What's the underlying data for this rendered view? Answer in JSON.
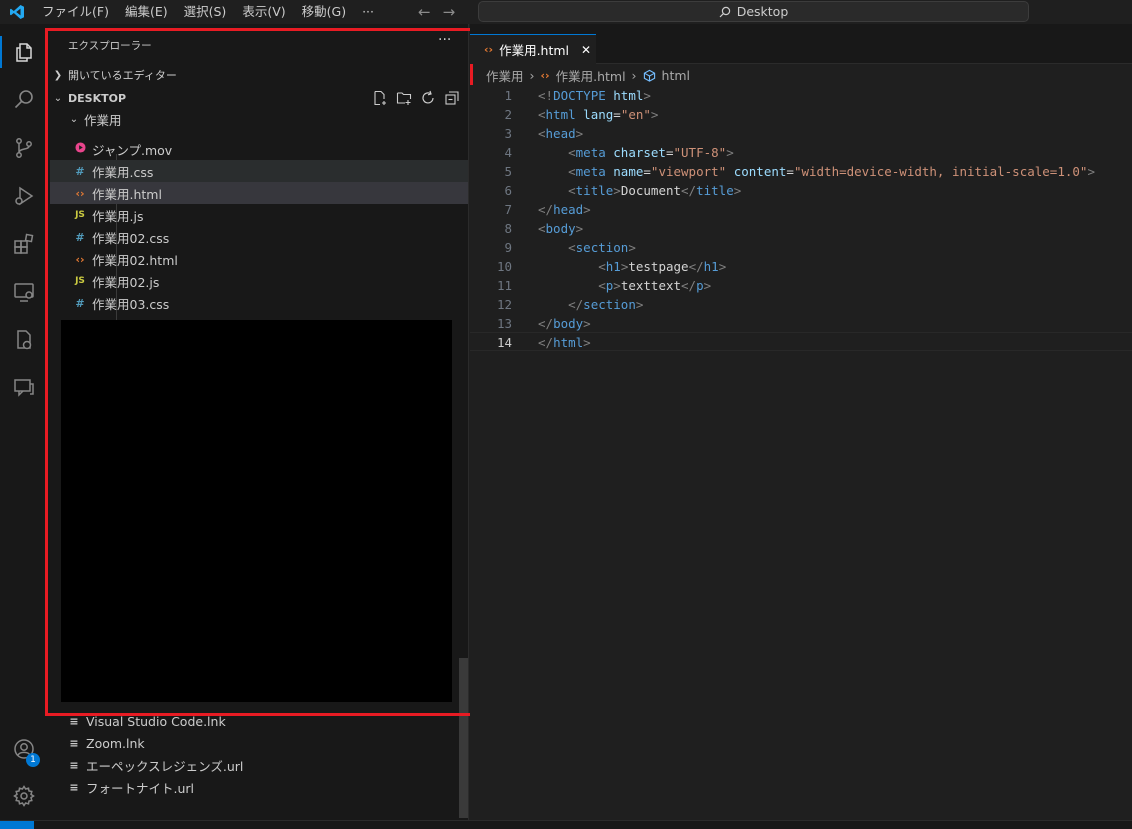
{
  "titlebar": {
    "menu": [
      "ファイル(F)",
      "編集(E)",
      "選択(S)",
      "表示(V)",
      "移動(G)",
      "···"
    ],
    "search_label": "Desktop"
  },
  "activity": {
    "account_badge": "1"
  },
  "explorer": {
    "header": "エクスプローラー",
    "more": "···",
    "open_editors": "開いているエディター",
    "workspace": "DESKTOP",
    "folder": "作業用",
    "files_top": [
      {
        "name": "ジャンプ.mov",
        "icon": "video-file-icon"
      },
      {
        "name": "作業用.css",
        "icon": "css-file-icon"
      },
      {
        "name": "作業用.html",
        "icon": "html-file-icon"
      },
      {
        "name": "作業用.js",
        "icon": "js-file-icon"
      },
      {
        "name": "作業用02.css",
        "icon": "css-file-icon"
      },
      {
        "name": "作業用02.html",
        "icon": "html-file-icon"
      },
      {
        "name": "作業用02.js",
        "icon": "js-file-icon"
      },
      {
        "name": "作業用03.css",
        "icon": "css-file-icon"
      }
    ],
    "files_bottom": [
      "Visual Studio Code.lnk",
      "Zoom.lnk",
      "エーペックスレジェンズ.url",
      "フォートナイト.url"
    ]
  },
  "editor": {
    "tab_label": "作業用.html",
    "breadcrumb": [
      "作業用",
      "作業用.html",
      "html"
    ],
    "current_line": 14
  },
  "colors": {
    "accent": "#0078d4",
    "highlight_box": "#e81b23"
  }
}
